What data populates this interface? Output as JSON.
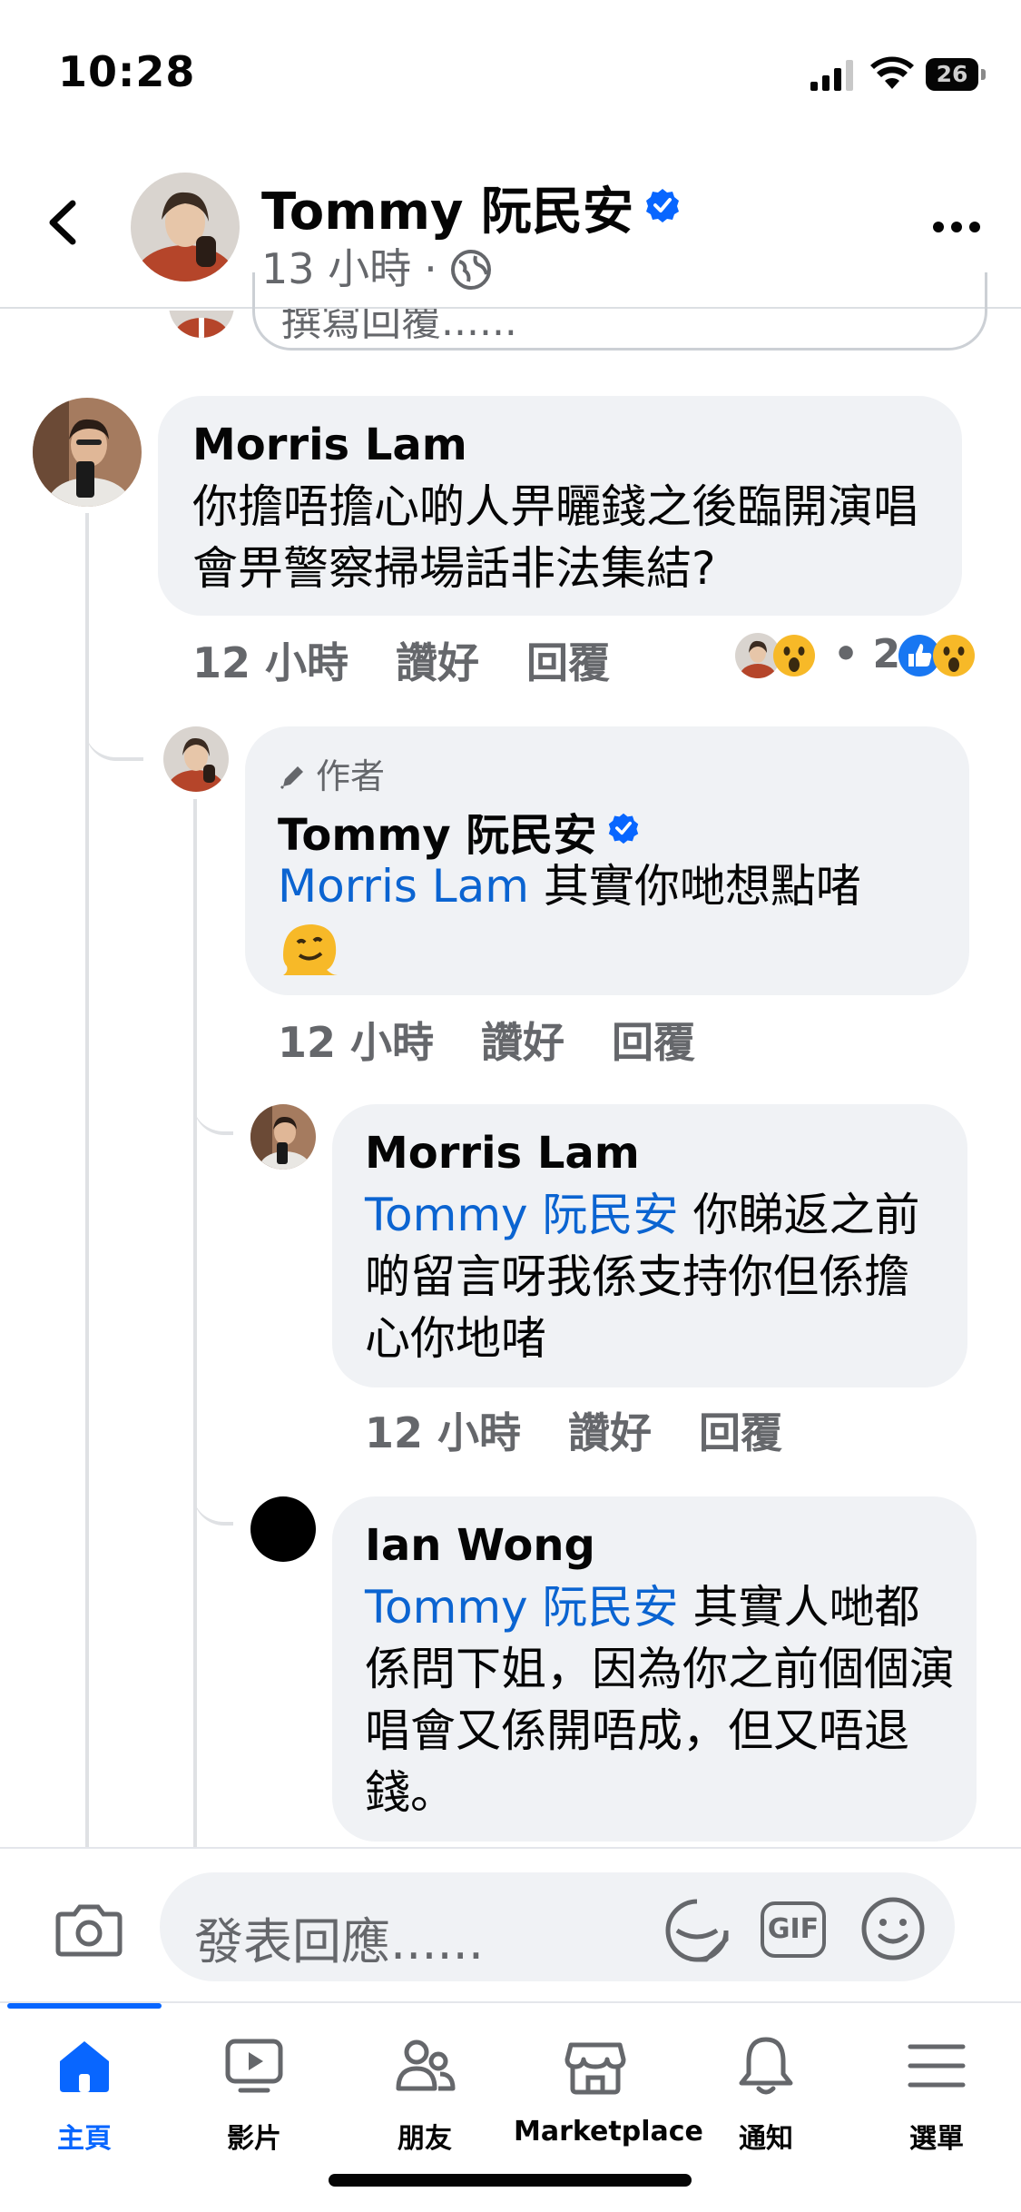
{
  "status_bar": {
    "time": "10:28",
    "battery": "26",
    "battery_level": 0.26
  },
  "header": {
    "name": "Tommy 阮民安",
    "time": "13 小時",
    "dot": "·"
  },
  "partial_reply": {
    "placeholder": "撰寫回覆......"
  },
  "comments": [
    {
      "name": "Morris Lam",
      "text": "你擔唔擔心啲人畀曬錢之後臨開演唱會畀警察掃場話非法集結?",
      "time": "12 小時",
      "like": "讚好",
      "reply": "回覆",
      "reaction_count": "• 2"
    },
    {
      "author_tag": "作者",
      "name": "Tommy 阮民安",
      "mention": "Morris Lam",
      "text": "其實你哋想點啫",
      "time": "12 小時",
      "like": "讚好",
      "reply": "回覆"
    },
    {
      "name": "Morris Lam",
      "mention": "Tommy 阮民安",
      "text": "你睇返之前啲留言呀我係支持你但係擔心你地啫",
      "time": "12 小時",
      "like": "讚好",
      "reply": "回覆"
    },
    {
      "name": "Ian Wong",
      "mention": "Tommy 阮民安",
      "text": "其實人哋都係問下姐，因為你之前個個演唱會又係開唔成，但又唔退錢。"
    }
  ],
  "composer": {
    "placeholder": "發表回應......",
    "gif": "GIF"
  },
  "tabs": [
    {
      "label": "主頁",
      "icon": "home-icon",
      "active": true
    },
    {
      "label": "影片",
      "icon": "video-icon"
    },
    {
      "label": "朋友",
      "icon": "friends-icon"
    },
    {
      "label": "Marketplace",
      "icon": "marketplace-icon"
    },
    {
      "label": "通知",
      "icon": "bell-icon"
    },
    {
      "label": "選單",
      "icon": "menu-icon"
    }
  ],
  "colors": {
    "accent": "#0866ff",
    "mention": "#0b64d1",
    "bubble": "#f0f2f5",
    "secondary_text": "#65676b"
  }
}
